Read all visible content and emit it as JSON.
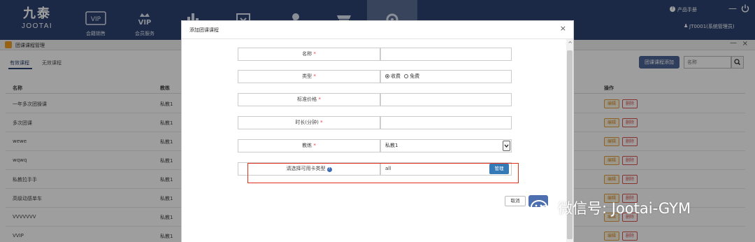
{
  "brand": {
    "mark": "九泰",
    "name": "JOOTAI"
  },
  "nav": {
    "items": [
      {
        "label": "会籍销售",
        "icon": "vip-card-icon"
      },
      {
        "label": "会员服务",
        "icon": "vip-crown-icon"
      },
      {
        "label": "",
        "icon": "chart-icon"
      },
      {
        "label": "",
        "icon": "calendar-icon"
      },
      {
        "label": "",
        "icon": "coach-icon"
      },
      {
        "label": "",
        "icon": "store-icon"
      },
      {
        "label": "",
        "icon": "settings-icon"
      }
    ],
    "help_label": "产品手册",
    "user_label": "JT0001(系统管理员)"
  },
  "subheader": {
    "title": "团课课程管理"
  },
  "tabs": [
    {
      "label": "有效课程",
      "active": true
    },
    {
      "label": "无效课程",
      "active": false
    }
  ],
  "toolbar": {
    "add_label": "团课课程添加",
    "search_placeholder": "名称"
  },
  "table": {
    "headers": {
      "name": "名称",
      "coach": "教练",
      "ops": "操作"
    },
    "rows": [
      {
        "name": "一年多次团操课",
        "coach": "私教1"
      },
      {
        "name": "多次团课",
        "coach": "私教1"
      },
      {
        "name": "wewe",
        "coach": "私教1"
      },
      {
        "name": "wqwq",
        "coach": "私教1"
      },
      {
        "name": "私教拉手手",
        "coach": "私教1"
      },
      {
        "name": "高级动感单车",
        "coach": "私教1"
      },
      {
        "name": "VVVVVVV",
        "coach": "私教1"
      },
      {
        "name": "VVIP",
        "coach": "私教1"
      }
    ],
    "edit_label": "编辑",
    "delete_label": "删除"
  },
  "modal": {
    "title": "添加团课课程",
    "fields": {
      "name_label": "名称",
      "type_label": "类型",
      "type_options": [
        "收费",
        "免费"
      ],
      "type_selected": "收费",
      "price_label": "标准价格",
      "duration_label": "时长(分钟)",
      "coach_label": "教练",
      "coach_value": "私教1",
      "card_label": "请选择可用卡类型",
      "card_value": "all",
      "manage_label": "管理"
    },
    "required_mark": "*",
    "cancel_label": "取消"
  },
  "watermark": {
    "text": "微信号: Jootai-GYM"
  },
  "colors": {
    "nav_bg": "#2c4372",
    "accent": "#4d6596",
    "danger": "#d9534f",
    "highlight": "#e03020"
  }
}
